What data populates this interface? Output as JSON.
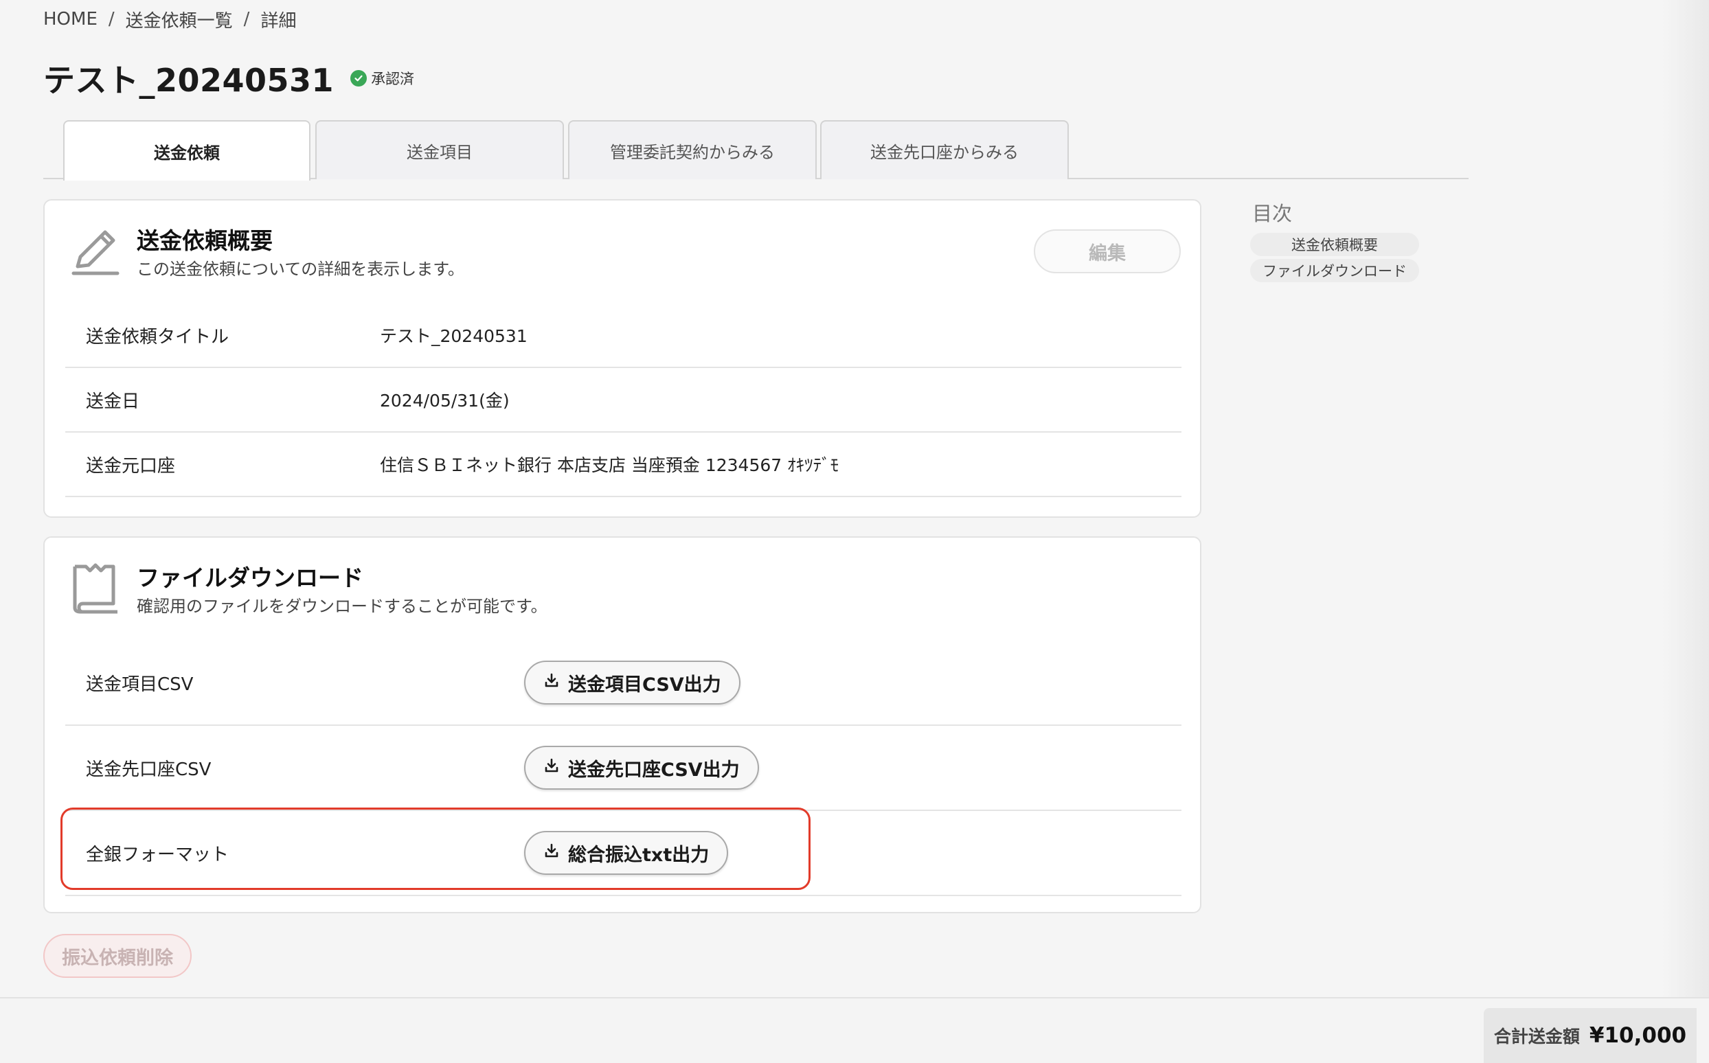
{
  "breadcrumb": {
    "home": "HOME",
    "list": "送金依頼一覧",
    "current": "詳細",
    "separator": "/"
  },
  "header": {
    "title": "テスト_20240531",
    "status": "承認済",
    "status_color": "#3aa757"
  },
  "tabs": [
    {
      "label": "送金依頼",
      "active": true
    },
    {
      "label": "送金項目",
      "active": false
    },
    {
      "label": "管理委託契約からみる",
      "active": false
    },
    {
      "label": "送金先口座からみる",
      "active": false
    }
  ],
  "summary": {
    "icon": "pencil-icon",
    "title": "送金依頼概要",
    "description": "この送金依頼についての詳細を表示します。",
    "edit_label": "編集",
    "rows": [
      {
        "label": "送金依頼タイトル",
        "value": "テスト_20240531"
      },
      {
        "label": "送金日",
        "value": "2024/05/31(金)"
      },
      {
        "label": "送金元口座",
        "value": "住信ＳＢＩネット銀行 本店支店 当座預金 1234567 ｵｷﾂﾃﾞﾓ"
      }
    ]
  },
  "download": {
    "icon": "document-icon",
    "title": "ファイルダウンロード",
    "description": "確認用のファイルをダウンロードすることが可能です。",
    "rows": [
      {
        "label": "送金項目CSV",
        "button": "送金項目CSV出力"
      },
      {
        "label": "送金先口座CSV",
        "button": "送金先口座CSV出力"
      },
      {
        "label": "全銀フォーマット",
        "button": "総合振込txt出力"
      }
    ],
    "highlight_color": "#e23b2a"
  },
  "delete_label": "振込依頼削除",
  "toc": {
    "heading": "目次",
    "items": [
      "送金依頼概要",
      "ファイルダウンロード"
    ]
  },
  "footer": {
    "total_label": "合計送金額",
    "total_value": "¥10,000"
  }
}
